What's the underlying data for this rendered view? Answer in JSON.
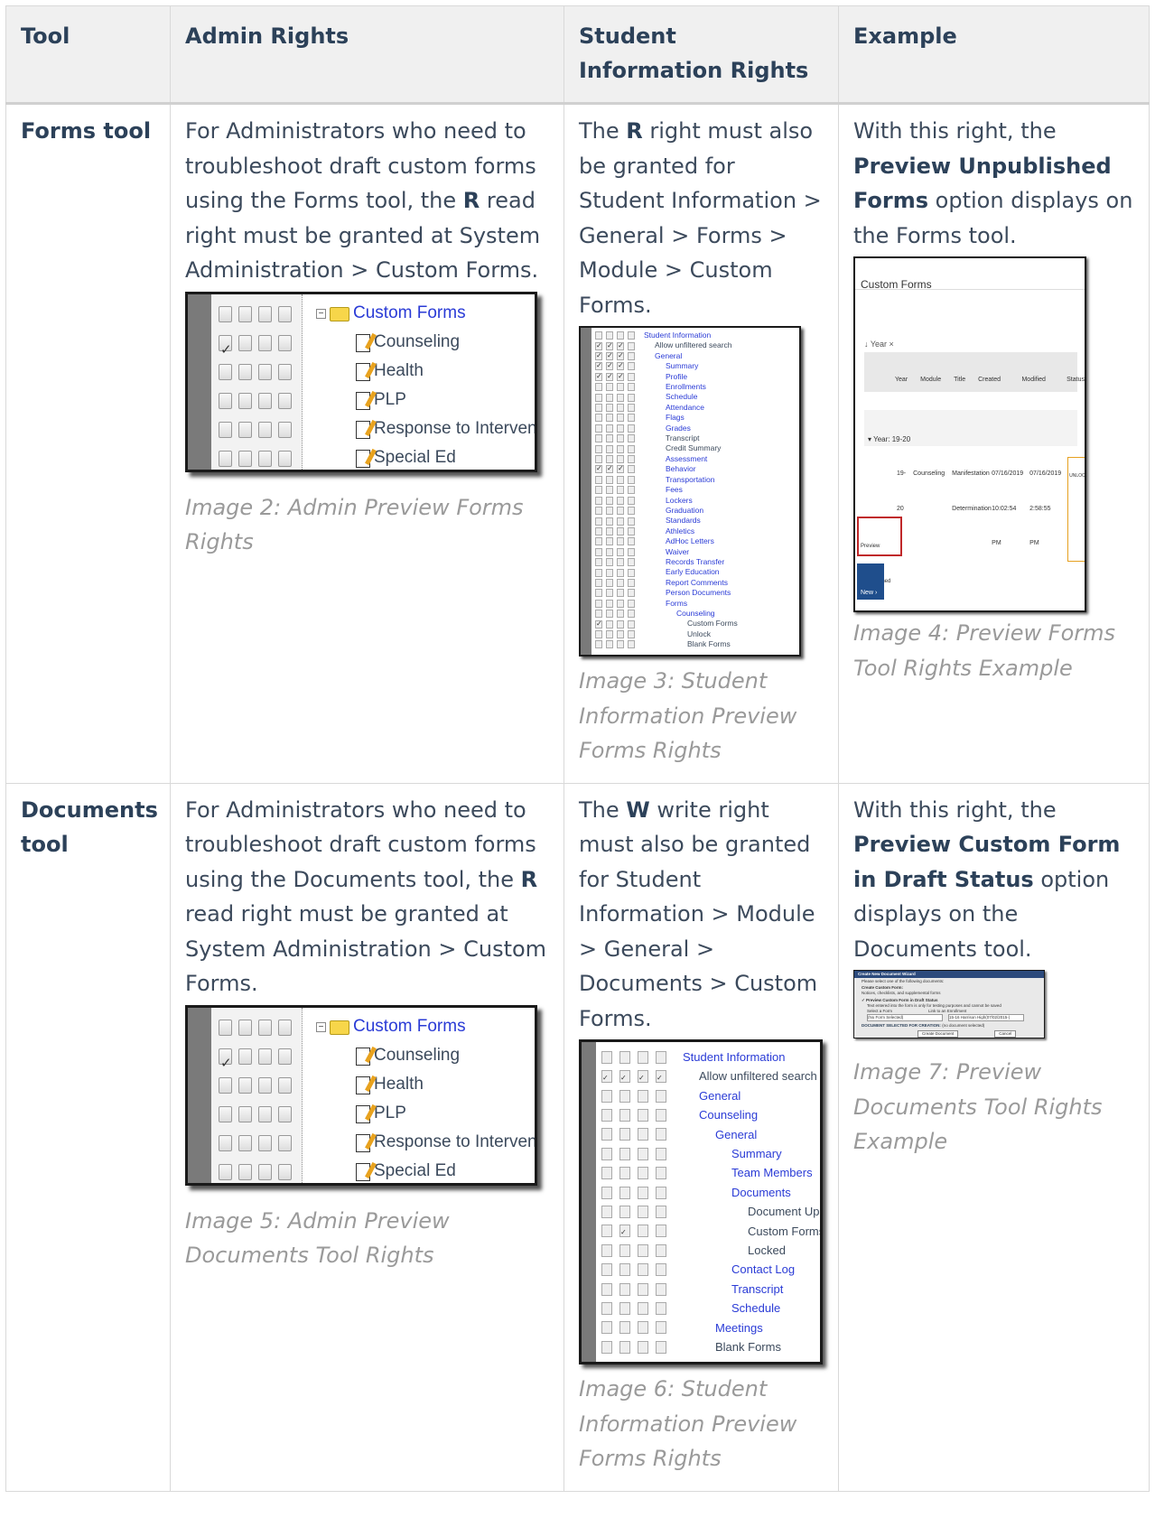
{
  "table": {
    "headers": [
      "Tool",
      "Admin Rights",
      "Student Information Rights",
      "Example"
    ]
  },
  "forms_row": {
    "tool": "Forms tool",
    "admin": {
      "text_1": "For Administrators who need to troubleshoot draft custom forms using the Forms tool, the ",
      "bold": "R",
      "text_2": " read right must be granted at System Administration > Custom Forms.",
      "caption": "Image 2: Admin Preview Forms Rights"
    },
    "student": {
      "text_1": "The ",
      "bold": "R",
      "text_2": " right must also be granted for Student Information > General > Forms > Module > Custom Forms.",
      "caption": "Image 3: Student Information Preview Forms Rights"
    },
    "example": {
      "text_1": "With this right, the ",
      "bold": "Preview Unpublished Forms",
      "text_2": " option displays on the Forms tool.",
      "caption": "Image 4: Preview Forms Tool Rights Example"
    }
  },
  "documents_row": {
    "tool": "Documents tool",
    "admin": {
      "text_1": "For Administrators who need to troubleshoot draft custom forms using the Documents tool, the ",
      "bold": "R",
      "text_2": " read right must be granted at System Administration > Custom Forms.",
      "caption": "Image 5: Admin Preview Documents Tool Rights"
    },
    "student": {
      "text_1": "The ",
      "bold": "W",
      "text_2": " write right must also be granted for Student Information > Module > General > Documents > Custom Forms.",
      "caption": "Image 6: Student Information Preview Forms Rights"
    },
    "example": {
      "text_1": "With this right, the ",
      "bold": "Preview Custom Form in Draft Status",
      "text_2": " option displays on the Documents tool.",
      "caption": "Image 7: Preview Documents Tool Rights Example"
    }
  },
  "admin_tree": {
    "root": "Custom Forms",
    "items": [
      "Counseling",
      "Health",
      "PLP",
      "Response to Intervention",
      "Special Ed"
    ]
  },
  "student_forms_tree": {
    "items": [
      "Student Information",
      "Allow unfiltered search",
      "General",
      "Summary",
      "Profile",
      "Enrollments",
      "Schedule",
      "Attendance",
      "Flags",
      "Grades",
      "Transcript",
      "Credit Summary",
      "Assessment",
      "Behavior",
      "Transportation",
      "Fees",
      "Lockers",
      "Graduation",
      "Standards",
      "Athletics",
      "AdHoc Letters",
      "Waiver",
      "Records Transfer",
      "Early Education",
      "Report Comments",
      "Person Documents",
      "Forms",
      "Counseling",
      "Custom Forms",
      "Unlock",
      "Blank Forms"
    ]
  },
  "student_docs_tree": {
    "items": [
      "Student Information",
      "Allow unfiltered search",
      "General",
      "Counseling",
      "General",
      "Summary",
      "Team Members",
      "Documents",
      "Document Upload",
      "Custom Forms",
      "Locked",
      "Contact Log",
      "Transcript",
      "Schedule",
      "Meetings",
      "Blank Forms"
    ]
  },
  "forms_example": {
    "title": "Custom Forms",
    "filter": "Year",
    "columns": [
      "Year",
      "Module",
      "Title",
      "Created Date",
      "Modified Date",
      "Status"
    ],
    "group": "Year: 19-20",
    "row": [
      "19-20",
      "Counseling",
      "Manifestation Determination",
      "07/16/2019 10:02:54 PM",
      "07/16/2019 2:58:55 PM",
      "UNLOCKED"
    ],
    "preview_button": "Preview Unpublished Forms",
    "new_button": "New"
  },
  "docs_example": {
    "title": "Create New Document Wizard",
    "line_1": "Please select one of the following documents:",
    "line_2": "Create Custom Form:",
    "line_3": "Notices, checklists, and supplemental forms",
    "option": "Preview Custom Form in Draft Status",
    "option_note": "Text entered into the form is only for testing purposes and cannot be saved",
    "select_label": "Select a Form",
    "link_label": "Link to an Enrollment",
    "select_value": "(No Form Selected)",
    "link_value": "15-16 Harrison High(07/02/2015-)",
    "selected": "DOCUMENT SELECTED FOR CREATION:",
    "selected_value": "(no document selected)",
    "create": "Create Document",
    "cancel": "Cancel"
  }
}
